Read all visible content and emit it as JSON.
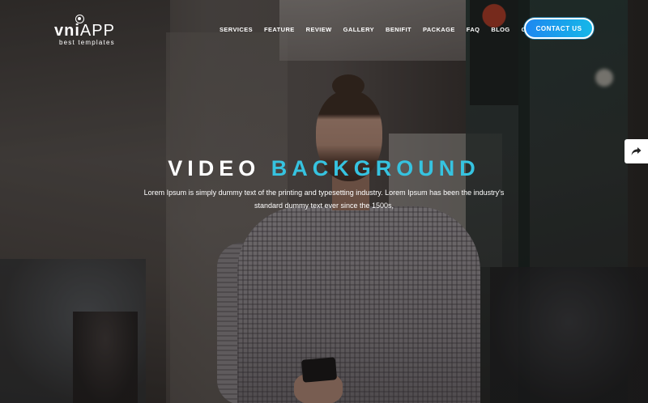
{
  "brand": {
    "name_bold": "vni",
    "name_light": "APP",
    "tagline": "best templates"
  },
  "nav": {
    "items": [
      "SERVICES",
      "FEATURE",
      "REVIEW",
      "GALLERY",
      "BENIFIT",
      "PACKAGE",
      "FAQ",
      "BLOG",
      "CONTACT"
    ],
    "cta_label": "CONTACT US"
  },
  "hero": {
    "title_word1": "VIDEO",
    "title_word2": "BACKGROUND",
    "subtitle": "Lorem Ipsum is simply dummy text of the printing and typesetting industry. Lorem Ipsum has been the industry's standard dummy text ever since the 1500s,"
  },
  "side": {
    "share_icon": "share-arrow-icon"
  },
  "colors": {
    "accent": "#36c3e0",
    "button_gradient_start": "#1e88f0",
    "button_gradient_end": "#16b7e8"
  }
}
